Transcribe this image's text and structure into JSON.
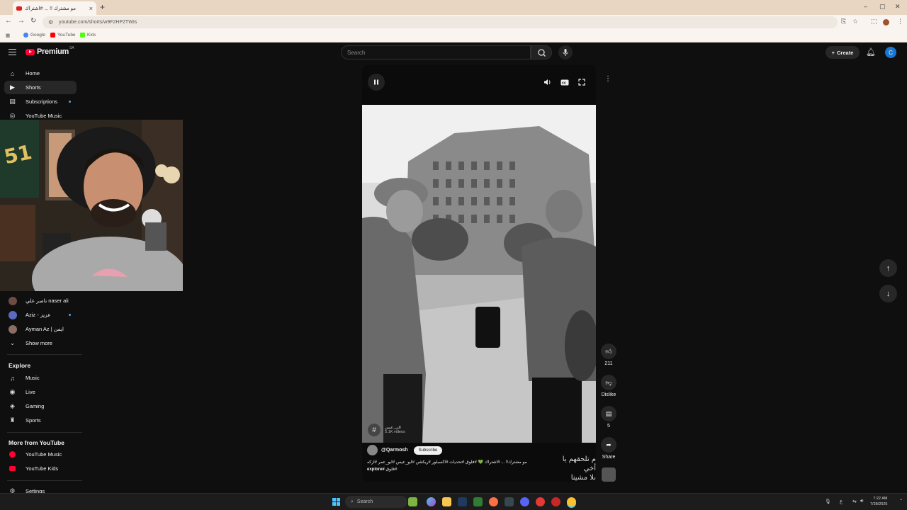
{
  "browser": {
    "tab_title": "مو مشترك !! ... #اشتراك",
    "tab_close": "×",
    "new_tab": "+",
    "url": "youtube.com/shorts/w9F2HP2TWIs",
    "bookmarks": [
      {
        "label": "Google",
        "color": "#4285f4"
      },
      {
        "label": "YouTube",
        "color": "#ff0000"
      },
      {
        "label": "Kick",
        "color": "#53fc18"
      }
    ]
  },
  "header": {
    "logo_text": "Premium",
    "logo_country": "SA",
    "search_placeholder": "Search",
    "create_label": "Create",
    "avatar_letter": "C"
  },
  "sidebar": {
    "main": [
      {
        "label": "Home",
        "icon": "home-icon",
        "glyph": "⌂"
      },
      {
        "label": "Shorts",
        "icon": "shorts-icon",
        "glyph": "▶",
        "active": true
      },
      {
        "label": "Subscriptions",
        "icon": "subscriptions-icon",
        "glyph": "▤",
        "live": true
      },
      {
        "label": "YouTube Music",
        "icon": "youtube-music-icon",
        "glyph": "◎"
      }
    ],
    "channels": [
      {
        "label": "ناصر علي naser ali"
      },
      {
        "label": "Aziz - عزيز",
        "live": true
      },
      {
        "label": "Ayman Az | ايمن"
      }
    ],
    "show_more": "Show more",
    "explore_heading": "Explore",
    "explore": [
      {
        "label": "Music",
        "icon": "music-icon",
        "glyph": "♫"
      },
      {
        "label": "Live",
        "icon": "live-icon",
        "glyph": "◉"
      },
      {
        "label": "Gaming",
        "icon": "gaming-icon",
        "glyph": "◈"
      },
      {
        "label": "Sports",
        "icon": "sports-icon",
        "glyph": "♜"
      }
    ],
    "more_heading": "More from YouTube",
    "more": [
      {
        "label": "YouTube Music",
        "icon": "youtube-music-icon"
      },
      {
        "label": "YouTube Kids",
        "icon": "youtube-kids-icon"
      }
    ],
    "settings": "Settings"
  },
  "short": {
    "hashtag_name": "الي_عيس",
    "hashtag_count": "5.1K videos",
    "channel": "@Qarmosh",
    "subscribe": "Subscribe",
    "caption": "مو مشترك!! ... #اشتراك 💚 #فلوق #تحديات #اكسبلور #ريكشن #ابو_عيس #ابو_عمر #ازكه #فلوق",
    "caption_tag": "#explore",
    "subtitle_line1": "م تلحقهم يا أخي",
    "subtitle_line2": "يلا مشينا مشينا"
  },
  "actions": {
    "like_count": "211",
    "dislike_label": "Dislike",
    "comment_count": "5",
    "share_label": "Share"
  },
  "taskbar": {
    "search_label": "Search",
    "time": "7:22 AM",
    "date": "7/28/2025",
    "lang": "ع"
  },
  "colors": {
    "accent_red": "#ff0033",
    "link_blue": "#3ea6ff",
    "avatar_blue": "#1976d2"
  }
}
